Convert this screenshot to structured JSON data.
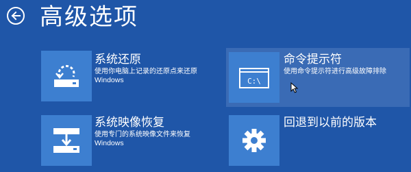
{
  "header": {
    "title": "高级选项",
    "back_icon": "back-arrow-icon"
  },
  "options": [
    {
      "id": "system-restore",
      "title": "系统还原",
      "description_line1": "使用你电脑上记录的还原点来还原",
      "description_line2": "Windows",
      "icon": "system-restore-icon"
    },
    {
      "id": "command-prompt",
      "title": "命令提示符",
      "description_line1": "使用命令提示符进行高级故障排除",
      "icon": "command-prompt-icon",
      "icon_text": "C:\\"
    },
    {
      "id": "system-image-recovery",
      "title": "系统映像恢复",
      "description_line1": "使用专门的系统映像文件来恢复",
      "description_line2": "Windows",
      "icon": "drive-download-icon"
    },
    {
      "id": "go-back",
      "title": "回退到以前的版本",
      "icon": "gear-icon"
    }
  ],
  "colors": {
    "background": "#1f56a8",
    "tile": "#3d7fd0",
    "highlight": "#3a6bb5",
    "text": "#ffffff"
  }
}
